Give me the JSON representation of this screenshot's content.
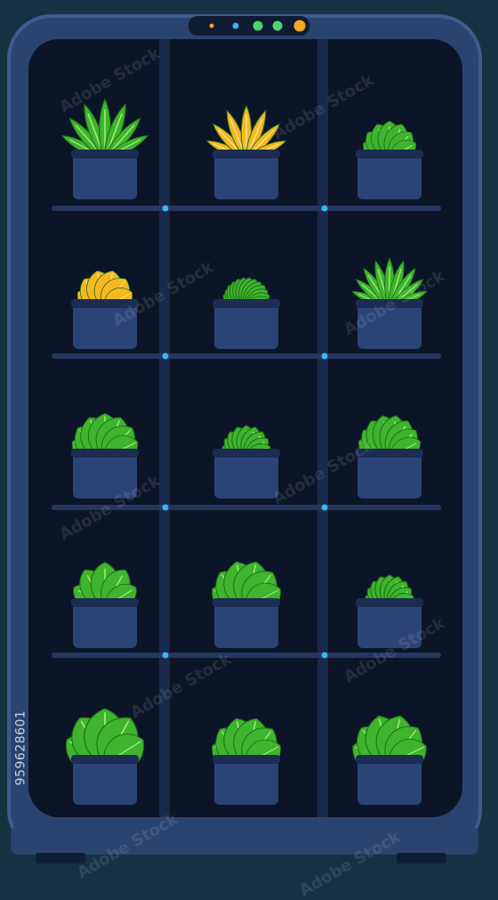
{
  "stock_id": "959628601",
  "watermark": "Adobe Stock",
  "colors": {
    "background": "#153243",
    "frame_outer": "#2a4470",
    "frame_edge": "#3c5c8e",
    "interior": "#0c1428",
    "rail": "#24385f",
    "pot": "#2b4477",
    "pot_top": "#1c2c52",
    "indicator_dot": "#39b6f0",
    "led_orange": "#f5a623",
    "led_green": "#4fd36a",
    "leaf_green": "#3fb42e",
    "leaf_vein": "#a8ee7a",
    "leaf_yellow": "#f5b820"
  },
  "indicators": [
    "orange-dot",
    "blue-dot",
    "green-light",
    "green-light",
    "orange-light"
  ],
  "plants": [
    {
      "variety": "tall-stem leaves",
      "color": "green"
    },
    {
      "variety": "pointed leaves",
      "color": "yellow"
    },
    {
      "variety": "basil",
      "color": "green"
    },
    {
      "variety": "broad leaves",
      "color": "yellow"
    },
    {
      "variety": "bushy microgreens",
      "color": "green"
    },
    {
      "variety": "spinach",
      "color": "green"
    },
    {
      "variety": "lettuce",
      "color": "green"
    },
    {
      "variety": "round-leaf sprouts",
      "color": "green"
    },
    {
      "variety": "leafy greens",
      "color": "green"
    },
    {
      "variety": "round leaves",
      "color": "green"
    },
    {
      "variety": "curly lettuce",
      "color": "green"
    },
    {
      "variety": "round-leaf sprouts",
      "color": "green"
    },
    {
      "variety": "large-leaf lettuce",
      "color": "green"
    },
    {
      "variety": "curly lettuce",
      "color": "green"
    },
    {
      "variety": "chard",
      "color": "green"
    }
  ]
}
